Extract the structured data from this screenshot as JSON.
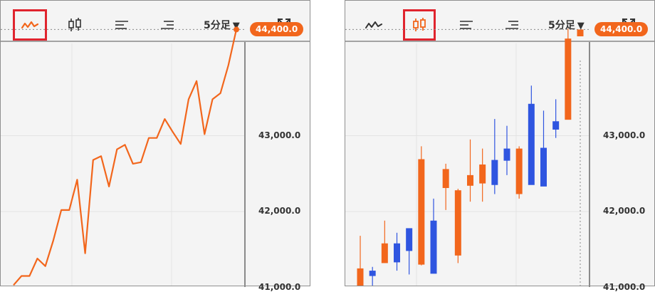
{
  "toolbar": {
    "line_icon": "line-chart-icon",
    "candle_icon": "candlestick-icon",
    "indicator_icon": "left-align-lines-icon",
    "list_icon": "right-align-lines-icon",
    "timeframe_label": "5分足",
    "timeframe_arrow": "▼",
    "fullscreen_icon": "expand-icon"
  },
  "colors": {
    "up": "#f2661c",
    "down": "#2f55e0",
    "line": "#f2661c",
    "selection": "#e0242e",
    "axis": "#8a8a8a"
  },
  "left_panel": {
    "selected_tool": "line"
  },
  "right_panel": {
    "selected_tool": "candle"
  },
  "price_badge": "44,400.0",
  "y_ticks": [
    {
      "value": 43000,
      "label": "43,000.0"
    },
    {
      "value": 42000,
      "label": "42,000.0"
    },
    {
      "value": 41000,
      "label": "41,000.0"
    }
  ],
  "chart_data": [
    {
      "type": "line",
      "title": "",
      "xlabel": "",
      "ylabel": "",
      "ylim": [
        40900,
        44500
      ],
      "current_price": 44400,
      "values": [
        41030,
        41150,
        41150,
        41380,
        41280,
        41620,
        42020,
        42020,
        42420,
        41450,
        42680,
        42730,
        42330,
        42820,
        42880,
        42630,
        42650,
        42970,
        42970,
        43220,
        43050,
        42890,
        43480,
        43720,
        43020,
        43480,
        43560,
        43930,
        44400
      ],
      "grid": true
    },
    {
      "type": "candlestick",
      "title": "",
      "xlabel": "",
      "ylabel": "",
      "ylim": [
        40900,
        44500
      ],
      "current_price": 44400,
      "candles": [
        {
          "open": 41250,
          "high": 41680,
          "low": 40850,
          "close": 40980,
          "dir": "up"
        },
        {
          "open": 41150,
          "high": 41270,
          "low": 40980,
          "close": 41220,
          "dir": "down"
        },
        {
          "open": 41580,
          "high": 41880,
          "low": 41520,
          "close": 41320,
          "dir": "up"
        },
        {
          "open": 41330,
          "high": 41720,
          "low": 41220,
          "close": 41580,
          "dir": "down"
        },
        {
          "open": 41480,
          "high": 41730,
          "low": 41170,
          "close": 41780,
          "dir": "down"
        },
        {
          "open": 42690,
          "high": 42860,
          "low": 41290,
          "close": 41300,
          "dir": "up"
        },
        {
          "open": 41880,
          "high": 42170,
          "low": 41470,
          "close": 41180,
          "dir": "down"
        },
        {
          "open": 42560,
          "high": 42630,
          "low": 42020,
          "close": 42310,
          "dir": "up"
        },
        {
          "open": 42280,
          "high": 42300,
          "low": 41320,
          "close": 41420,
          "dir": "up"
        },
        {
          "open": 42480,
          "high": 42950,
          "low": 42130,
          "close": 42340,
          "dir": "up"
        },
        {
          "open": 42620,
          "high": 42830,
          "low": 42130,
          "close": 42370,
          "dir": "up"
        },
        {
          "open": 42350,
          "high": 43220,
          "low": 42230,
          "close": 42680,
          "dir": "down"
        },
        {
          "open": 42670,
          "high": 43130,
          "low": 42480,
          "close": 42830,
          "dir": "down"
        },
        {
          "open": 42830,
          "high": 42860,
          "low": 42170,
          "close": 42230,
          "dir": "up"
        },
        {
          "open": 42350,
          "high": 43660,
          "low": 42500,
          "close": 43420,
          "dir": "down"
        },
        {
          "open": 42330,
          "high": 43330,
          "low": 42340,
          "close": 42840,
          "dir": "down"
        },
        {
          "open": 43080,
          "high": 43480,
          "low": 42970,
          "close": 43190,
          "dir": "down"
        },
        {
          "open": 44280,
          "high": 44410,
          "low": 43230,
          "close": 43210,
          "dir": "up"
        },
        {
          "open": 44400,
          "high": 44380,
          "low": 44310,
          "close": 44310,
          "dir": "up"
        }
      ],
      "grid": true
    }
  ]
}
